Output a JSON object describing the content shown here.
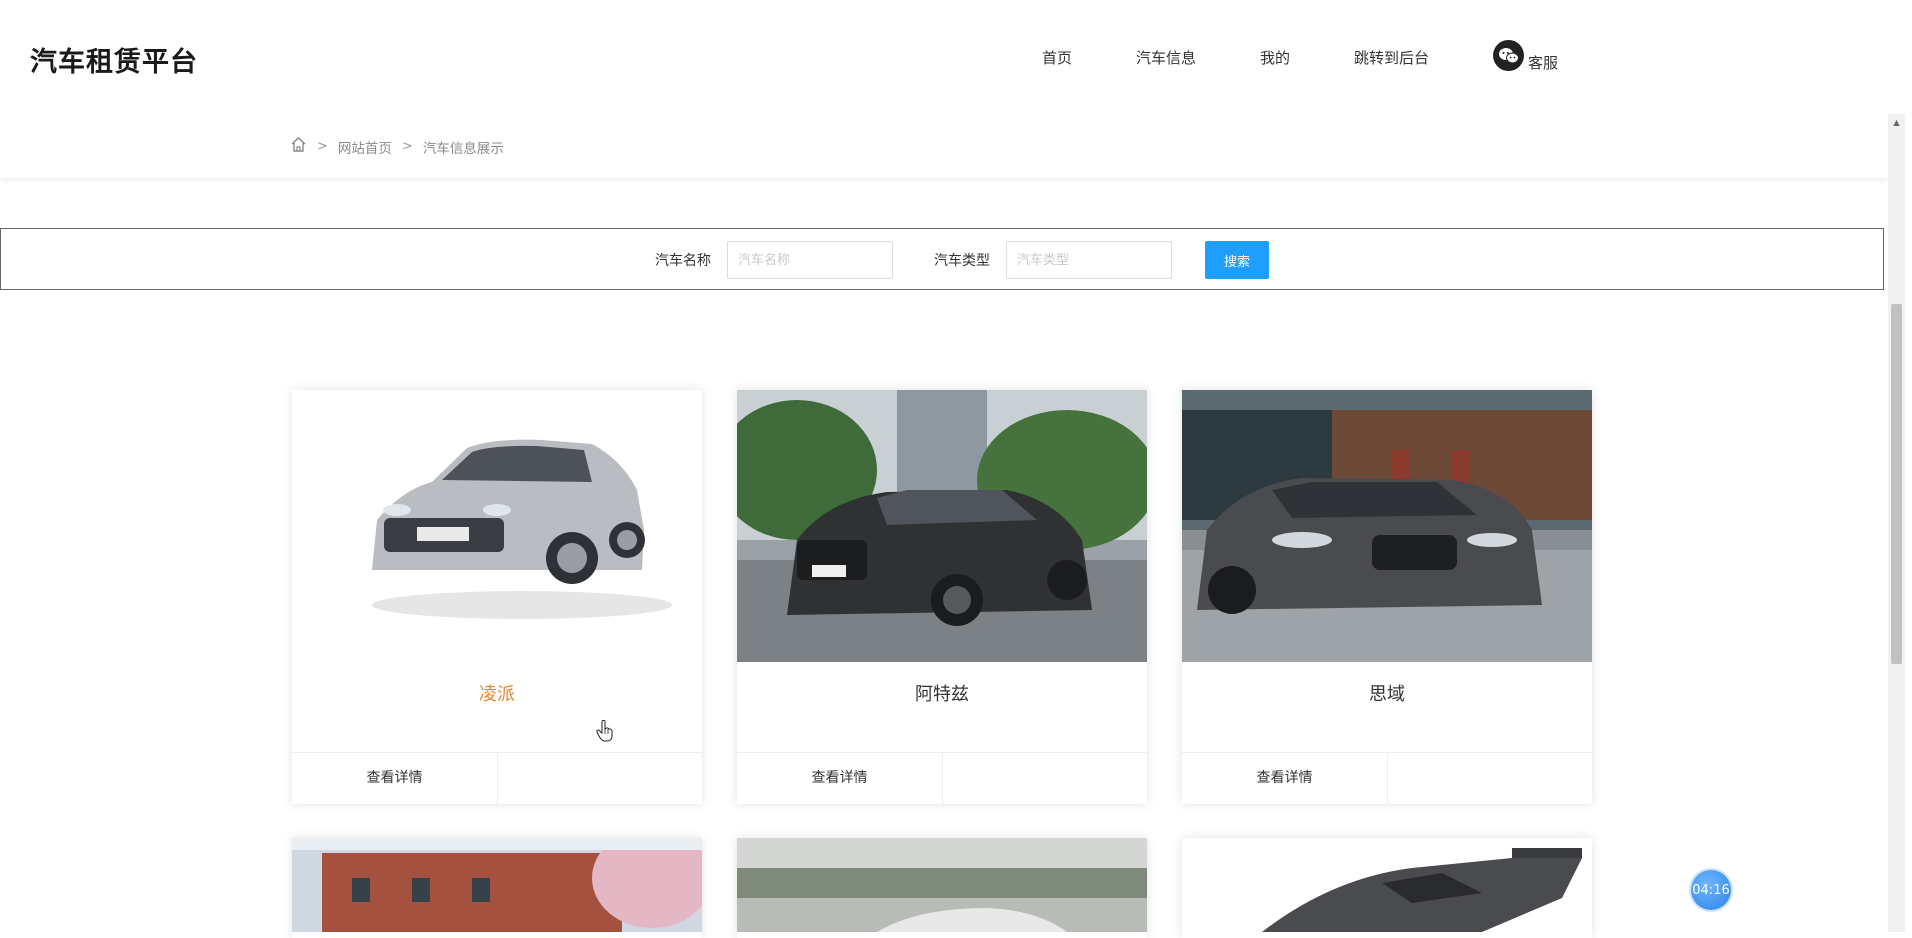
{
  "header": {
    "brand": "汽车租赁平台",
    "nav": [
      {
        "label": "首页"
      },
      {
        "label": "汽车信息"
      },
      {
        "label": "我的"
      },
      {
        "label": "跳转到后台"
      }
    ],
    "service": {
      "label": "客服",
      "icon": "wechat-icon"
    }
  },
  "breadcrumb": {
    "home_icon": "home-icon",
    "items": [
      "网站首页",
      "汽车信息展示"
    ]
  },
  "search": {
    "name_label": "汽车名称",
    "name_placeholder": "汽车名称",
    "name_value": "",
    "type_label": "汽车类型",
    "type_placeholder": "汽车类型",
    "type_value": "",
    "button": "搜索",
    "button_color": "#1e9fff"
  },
  "cards": [
    {
      "title": "凌派",
      "action": "查看详情",
      "highlight": true
    },
    {
      "title": "阿特兹",
      "action": "查看详情",
      "highlight": false
    },
    {
      "title": "思域",
      "action": "查看详情",
      "highlight": false
    }
  ],
  "colors": {
    "accent": "#1e9fff",
    "title_highlight": "#e4862a"
  },
  "timer": "04:16"
}
